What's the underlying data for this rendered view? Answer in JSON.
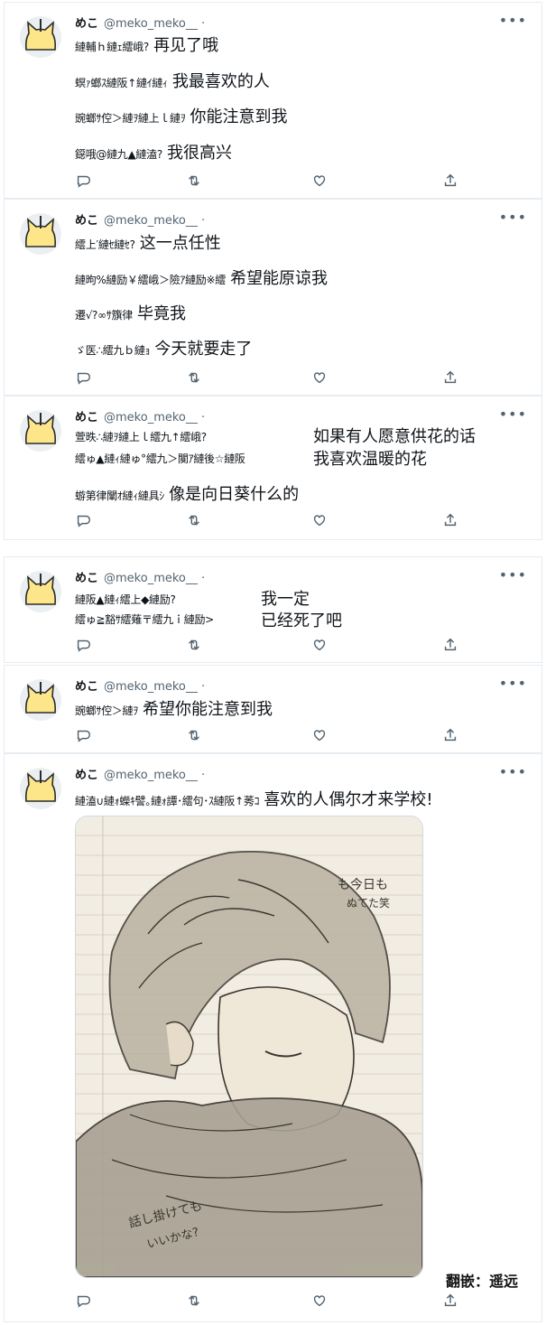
{
  "user": {
    "name": "めこ",
    "handle": "@meko_meko__",
    "dot": "·",
    "more": "•••"
  },
  "tweets": [
    {
      "lines": [
        {
          "jp": "縺輔ｈ縺ｪ繧峨?",
          "zh": "再见了哦"
        },
        {
          "jp": "螟ｧ螂ｽ縺阪↑縺ｲ縺ｨ",
          "zh": "我最喜欢的人"
        },
        {
          "jp": "豌螂ｻ倥＞縺ｦ縺上ｌ縺ｦ",
          "zh": "你能注意到我"
        },
        {
          "jp": "鐚哦@縺九▲縺溘?",
          "zh": "我很高兴"
        }
      ]
    },
    {
      "lines": [
        {
          "jp": "繧上′縺ｾ縺ｾ?",
          "zh": "这一点任性"
        },
        {
          "jp": "縺昫%縺励￥繧峨＞險ｱ縺励※繧",
          "zh": "希望能原谅我"
        },
        {
          "jp": "遷√?∞ｻ籏律",
          "zh": "毕竟我"
        },
        {
          "jp": "ゞ医∴繧九ｂ縺ｮ",
          "zh": "今天就要走了"
        }
      ]
    },
    {
      "lines": [
        {
          "jp": "萱昳∴縺ｦ縺上ｌ繧九↑繧峨?",
          "zh": "如果有人愿意供花的话"
        },
        {
          "jp": "繧ゅ▲縺ｨ縺ゅ°繧九＞闃ｱ縺後☆縺阪",
          "zh": "我喜欢温暖的花"
        },
        {
          "jp": "蝣第律闡ｵ縺ｨ縺具ｼ",
          "zh": "像是向日葵什么的"
        }
      ]
    },
    {
      "lines": [
        {
          "jp": "縺阪▲縺ｨ繧上◆縺励?",
          "zh": "我一定"
        },
        {
          "jp": "繧ゅ≧豁ｻ繧薙〒繧九ｉ縺励>",
          "zh": "已经死了吧"
        }
      ]
    },
    {
      "lines": [
        {
          "jp": "豌螂ｻ倥＞縺ｦ",
          "zh": "希望你能注意到我"
        }
      ]
    },
    {
      "lines": [
        {
          "jp": "縺溘∪縺ｫ蠑ｷ譬｡縺ｫ譚･繧句･ｽ縺阪↑莠ｺ",
          "zh": "喜欢的人偶尔才来学校!"
        }
      ],
      "sketch_text": {
        "top_right_1": "も今日も",
        "top_right_2": "ぬてた笑",
        "bottom_left_1": "話し掛けても",
        "bottom_left_2": "いいかな?"
      }
    }
  ],
  "credit": "翻嵌：遥远",
  "icons": [
    "reply-icon",
    "retweet-icon",
    "like-icon",
    "share-icon",
    "cat-avatar-icon",
    "more-icon"
  ],
  "colors": {
    "border": "#e6ecf0",
    "muted": "#536471",
    "text": "#0f1419",
    "avatar_fill": "#fde68a"
  }
}
